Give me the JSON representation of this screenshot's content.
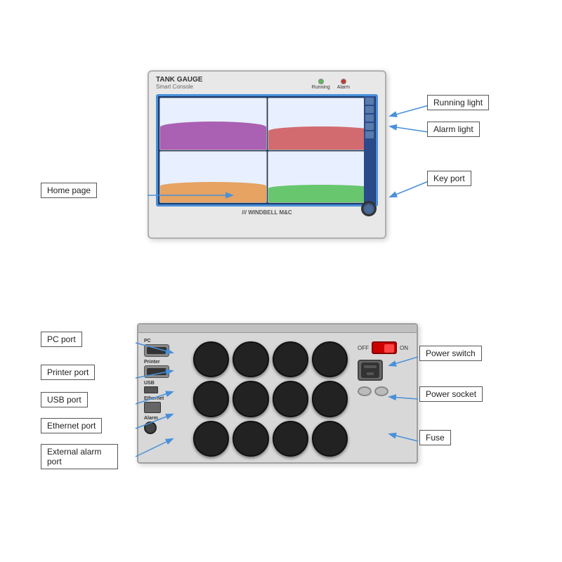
{
  "top_device": {
    "title": "TANK GAUGE",
    "subtitle": "Smart Console",
    "brand": "/// WINDBELL M&C",
    "lights": [
      {
        "id": "running",
        "label": "Running",
        "color": "green"
      },
      {
        "id": "alarm",
        "label": "Alarm",
        "color": "red"
      }
    ],
    "labels": {
      "running_light": "Running light",
      "alarm_light": "Alarm light",
      "key_port": "Key port",
      "home_page": "Home page"
    }
  },
  "bottom_device": {
    "labels": {
      "pc_port": "PC port",
      "printer_port": "Printer port",
      "usb_port": "USB port",
      "ethernet_port": "Ethernet port",
      "external_alarm_port": "External alarm\nport",
      "power_switch": "Power switch",
      "power_socket": "Power socket",
      "fuse": "Fuse"
    },
    "port_labels": {
      "pc": "PC",
      "printer": "Printer",
      "usb": "USB",
      "ethernet": "Ethernet",
      "alarm": "Alarm"
    },
    "switch_labels": {
      "off": "OFF",
      "on": "ON"
    }
  },
  "arrow_color": "#4a90d9",
  "label_border_color": "#555555"
}
